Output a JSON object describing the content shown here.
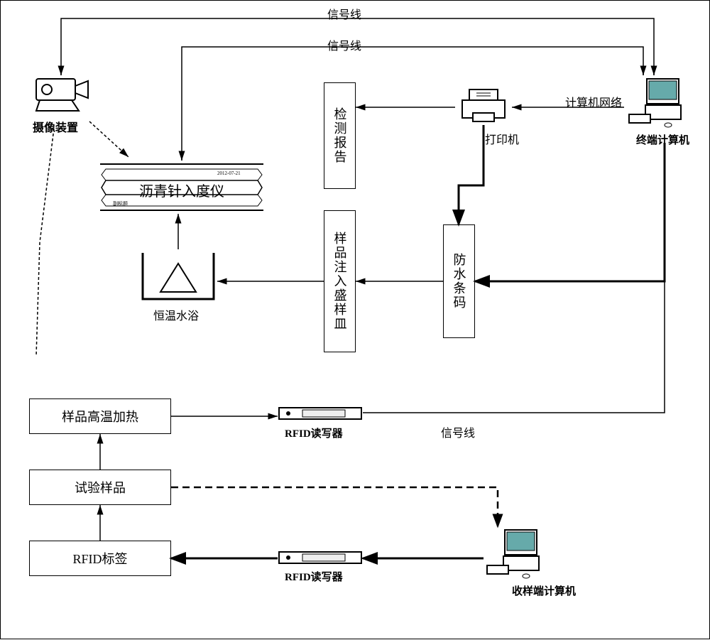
{
  "labels": {
    "signal_line": "信号线",
    "computer_network": "计算机网络",
    "printer": "打印机",
    "camera": "摄像装置",
    "terminal_computer": "终端计算机",
    "penetrometer": "沥青针入度仪",
    "test_report": "检测报告",
    "water_bath": "恒温水浴",
    "inject_dish": "样品注入盛样皿",
    "waterproof_barcode": "防水条码",
    "sample_heat": "样品高温加热",
    "rfid_reader": "RFID读写器",
    "test_sample": "试验样品",
    "rfid_tag": "RFID标签",
    "receiver_computer": "收样端计算机",
    "date_small": "2012-07-21",
    "small_caption": "副标题"
  }
}
